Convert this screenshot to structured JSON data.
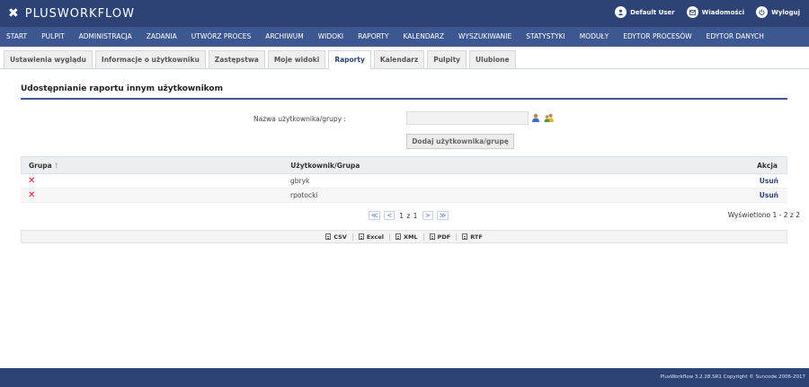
{
  "app": {
    "logo_text": "PLUSWORKFLOW"
  },
  "top_actions": [
    {
      "label": "Default User",
      "icon": "user-icon"
    },
    {
      "label": "Wiadomości",
      "icon": "mail-icon"
    },
    {
      "label": "Wyloguj",
      "icon": "power-icon"
    }
  ],
  "nav": [
    "START",
    "PULPIT",
    "ADMINISTRACJA",
    "ZADANIA",
    "UTWÓRZ PROCES",
    "ARCHIWUM",
    "WIDOKI",
    "RAPORTY",
    "KALENDARZ",
    "WYSZUKIWANIE",
    "STATYSTYKI",
    "MODUŁY",
    "EDYTOR PROCESÓW",
    "EDYTOR DANYCH"
  ],
  "tabs": [
    {
      "label": "Ustawienia wyglądu",
      "active": false
    },
    {
      "label": "Informacje o użytkowniku",
      "active": false
    },
    {
      "label": "Zastępstwa",
      "active": false
    },
    {
      "label": "Moje widoki",
      "active": false
    },
    {
      "label": "Raporty",
      "active": true
    },
    {
      "label": "Kalendarz",
      "active": false
    },
    {
      "label": "Pulpity",
      "active": false
    },
    {
      "label": "Ulubione",
      "active": false
    }
  ],
  "section": {
    "title": "Udostępnianie raportu innym użytkownikom"
  },
  "form": {
    "label": "Nazwa użytkownika/grupy :",
    "value": "",
    "add_button": "Dodaj użytkownika/grupę"
  },
  "grid": {
    "headers": {
      "group": "Grupa",
      "user": "Użytkownik/Grupa",
      "action": "Akcja"
    },
    "sort_arrow": "↑",
    "rows": [
      {
        "user": "gbryk",
        "action": "Usuń"
      },
      {
        "user": "rpotocki",
        "action": "Usuń"
      }
    ]
  },
  "pager": {
    "first": "≪",
    "prev": "<",
    "text": "1 z 1",
    "next": ">",
    "last": "≫",
    "info": "Wyświetlono 1 - 2 z 2"
  },
  "exports": [
    "CSV",
    "Excel",
    "XML",
    "PDF",
    "RTF"
  ],
  "footer": {
    "text": "PlusWorkflow 3.2.28.SR1 Copyright © Suncode 2006-2017"
  },
  "colors": {
    "header_bg": "#2d4375",
    "nav_bg": "#3d5891",
    "delete": "#e02020"
  }
}
